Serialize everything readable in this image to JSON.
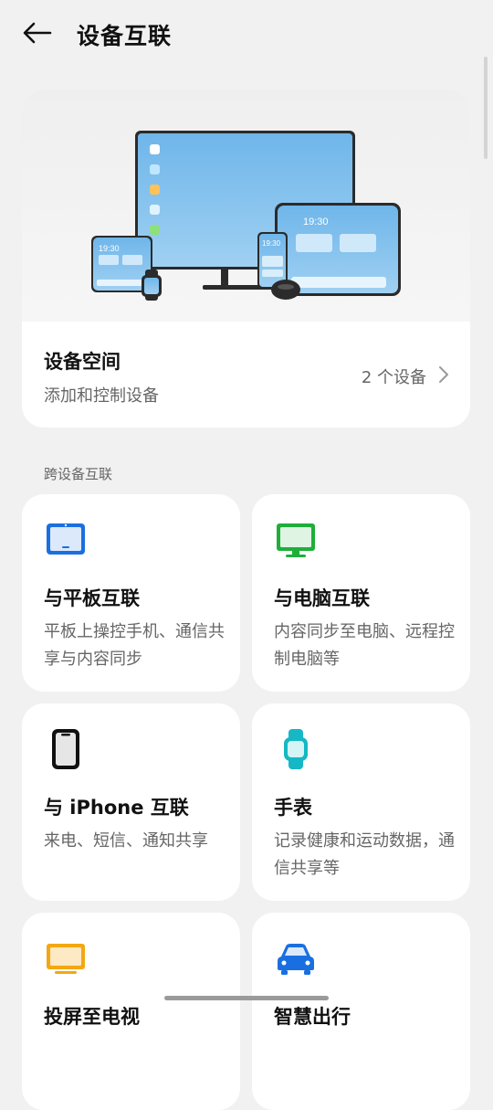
{
  "header": {
    "title": "设备互联"
  },
  "device_space": {
    "title": "设备空间",
    "subtitle": "添加和控制设备",
    "count": "2 个设备",
    "hero_time_tablet": "19:30",
    "hero_time_phone": "19:30",
    "hero_time_small": "19:30"
  },
  "section": {
    "label": "跨设备互联"
  },
  "tiles": [
    {
      "title": "与平板互联",
      "desc": "平板上操控手机、通信共享与内容同步",
      "icon": "tablet-icon",
      "color": "#1a6fe0"
    },
    {
      "title": "与电脑互联",
      "desc": "内容同步至电脑、远程控制电脑等",
      "icon": "monitor-icon",
      "color": "#1fae3a"
    },
    {
      "title": "与 iPhone 互联",
      "desc": "来电、短信、通知共享",
      "icon": "iphone-icon",
      "color": "#111111"
    },
    {
      "title": "手表",
      "desc": "记录健康和运动数据，通信共享等",
      "icon": "watch-icon",
      "color": "#15b8c4"
    },
    {
      "title": "投屏至电视",
      "desc": "",
      "icon": "tv-icon",
      "color": "#f3a712"
    },
    {
      "title": "智慧出行",
      "desc": "",
      "icon": "car-icon",
      "color": "#1a6fe0"
    }
  ]
}
